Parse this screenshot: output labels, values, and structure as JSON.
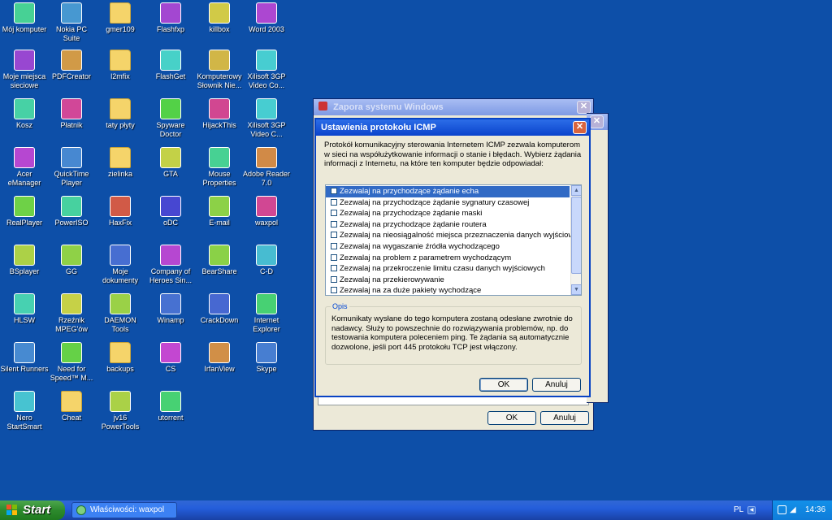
{
  "desktop": {
    "icons": [
      {
        "label": "Mój komputer",
        "icon": "my-computer-icon"
      },
      {
        "label": "Nokia PC Suite",
        "icon": "nokia-pc-suite-icon"
      },
      {
        "label": "gmer109",
        "icon": "folder-icon"
      },
      {
        "label": "Flashfxp",
        "icon": "flashfxp-icon"
      },
      {
        "label": "killbox",
        "icon": "killbox-icon"
      },
      {
        "label": "Word 2003",
        "icon": "word-icon"
      },
      {
        "label": "Moje miejsca sieciowe",
        "icon": "network-places-icon"
      },
      {
        "label": "PDFCreator",
        "icon": "pdfcreator-icon"
      },
      {
        "label": "l2mfix",
        "icon": "folder-icon"
      },
      {
        "label": "FlashGet",
        "icon": "flashget-icon"
      },
      {
        "label": "Komputerowy Słownik Nie...",
        "icon": "dictionary-icon"
      },
      {
        "label": "Xilisoft 3GP Video Co...",
        "icon": "xilisoft-icon"
      },
      {
        "label": "Kosz",
        "icon": "recycle-bin-icon"
      },
      {
        "label": "Płatnik",
        "icon": "platnik-icon"
      },
      {
        "label": "taty płyty",
        "icon": "folder-icon"
      },
      {
        "label": "Spyware Doctor",
        "icon": "spyware-doctor-icon"
      },
      {
        "label": "HijackThis",
        "icon": "hijackthis-icon"
      },
      {
        "label": "Xilisoft 3GP Video C...",
        "icon": "xilisoft-icon"
      },
      {
        "label": "Acer eManager",
        "icon": "acer-emanager-icon"
      },
      {
        "label": "QuickTime Player",
        "icon": "quicktime-icon"
      },
      {
        "label": "zielinka",
        "icon": "folder-icon"
      },
      {
        "label": "GTA",
        "icon": "gta-icon"
      },
      {
        "label": "Mouse Properties",
        "icon": "mouse-icon"
      },
      {
        "label": "Adobe Reader 7.0",
        "icon": "adobe-reader-icon"
      },
      {
        "label": "RealPlayer",
        "icon": "realplayer-icon"
      },
      {
        "label": "PowerISO",
        "icon": "poweriso-icon"
      },
      {
        "label": "HaxFix",
        "icon": "haxfix-icon"
      },
      {
        "label": "oDC",
        "icon": "odc-icon"
      },
      {
        "label": "E-mail",
        "icon": "email-icon"
      },
      {
        "label": "waxpol",
        "icon": "waxpol-icon"
      },
      {
        "label": "BSplayer",
        "icon": "bsplayer-icon"
      },
      {
        "label": "GG",
        "icon": "gadu-gadu-icon"
      },
      {
        "label": "Moje dokumenty",
        "icon": "my-documents-icon"
      },
      {
        "label": "Company of Heroes Sin...",
        "icon": "company-of-heroes-icon"
      },
      {
        "label": "BearShare",
        "icon": "bearshare-icon"
      },
      {
        "label": "C-D",
        "icon": "cd-icon"
      },
      {
        "label": "HLSW",
        "icon": "hlsw-icon"
      },
      {
        "label": "Rzeźnik MPEG'ów",
        "icon": "skull-icon"
      },
      {
        "label": "DAEMON Tools",
        "icon": "daemon-tools-icon"
      },
      {
        "label": "Winamp",
        "icon": "winamp-icon"
      },
      {
        "label": "CrackDown",
        "icon": "crackdown-icon"
      },
      {
        "label": "Internet Explorer",
        "icon": "internet-explorer-icon"
      },
      {
        "label": "Silent Runners",
        "icon": "silent-runners-icon"
      },
      {
        "label": "Need for Speed™ M...",
        "icon": "nfs-icon"
      },
      {
        "label": "backups",
        "icon": "folder-icon"
      },
      {
        "label": "CS",
        "icon": "cs-icon"
      },
      {
        "label": "IrfanView",
        "icon": "irfanview-icon"
      },
      {
        "label": "Skype",
        "icon": "skype-icon"
      },
      {
        "label": "Nero StartSmart",
        "icon": "nero-icon"
      },
      {
        "label": "Cheat",
        "icon": "folder-icon"
      },
      {
        "label": "jv16 PowerTools",
        "icon": "jv16-icon"
      },
      {
        "label": "utorrent",
        "icon": "utorrent-icon"
      }
    ]
  },
  "firewall_window": {
    "title": "Zapora systemu Windows",
    "ok_label": "OK",
    "cancel_label": "Anuluj"
  },
  "icmp_dialog": {
    "title": "Ustawienia protokołu ICMP",
    "description": "Protokół komunikacyjny sterowania Internetem ICMP zezwala komputerom w sieci na współużytkowanie informacji o stanie i błędach. Wybierz żądania informacji z Internetu, na które ten komputer będzie odpowiadał:",
    "options": [
      "Zezwalaj na przychodzące żądanie echa",
      "Zezwalaj na przychodzące żądanie sygnatury czasowej",
      "Zezwalaj na przychodzące żądanie maski",
      "Zezwalaj na przychodzące żądanie routera",
      "Zezwalaj na nieosiągalność miejsca przeznaczenia danych wyjściowych",
      "Zezwalaj na wygaszanie źródła wychodzącego",
      "Zezwalaj na problem z parametrem wychodzącym",
      "Zezwalaj na przekroczenie limitu czasu danych wyjściowych",
      "Zezwalaj na przekierowywanie",
      "Zezwalaj na za duże pakiety wychodzące"
    ],
    "selected_index": 0,
    "group_label": "Opis",
    "group_text": "Komunikaty wysłane do tego komputera zostaną odesłane zwrotnie do nadawcy. Służy to powszechnie do rozwiązywania problemów, np. do testowania komputera poleceniem ping. Te żądania są automatycznie dozwolone, jeśli port 445 protokołu TCP jest włączony.",
    "ok_label": "OK",
    "cancel_label": "Anuluj"
  },
  "taskbar": {
    "start_label": "Start",
    "task_label": "Właściwości: waxpol",
    "language": "PL",
    "clock": "14:36"
  },
  "colors": {
    "desktop": "#0d4fa8",
    "title_active": "#0a43cc",
    "selection": "#316ac5"
  }
}
